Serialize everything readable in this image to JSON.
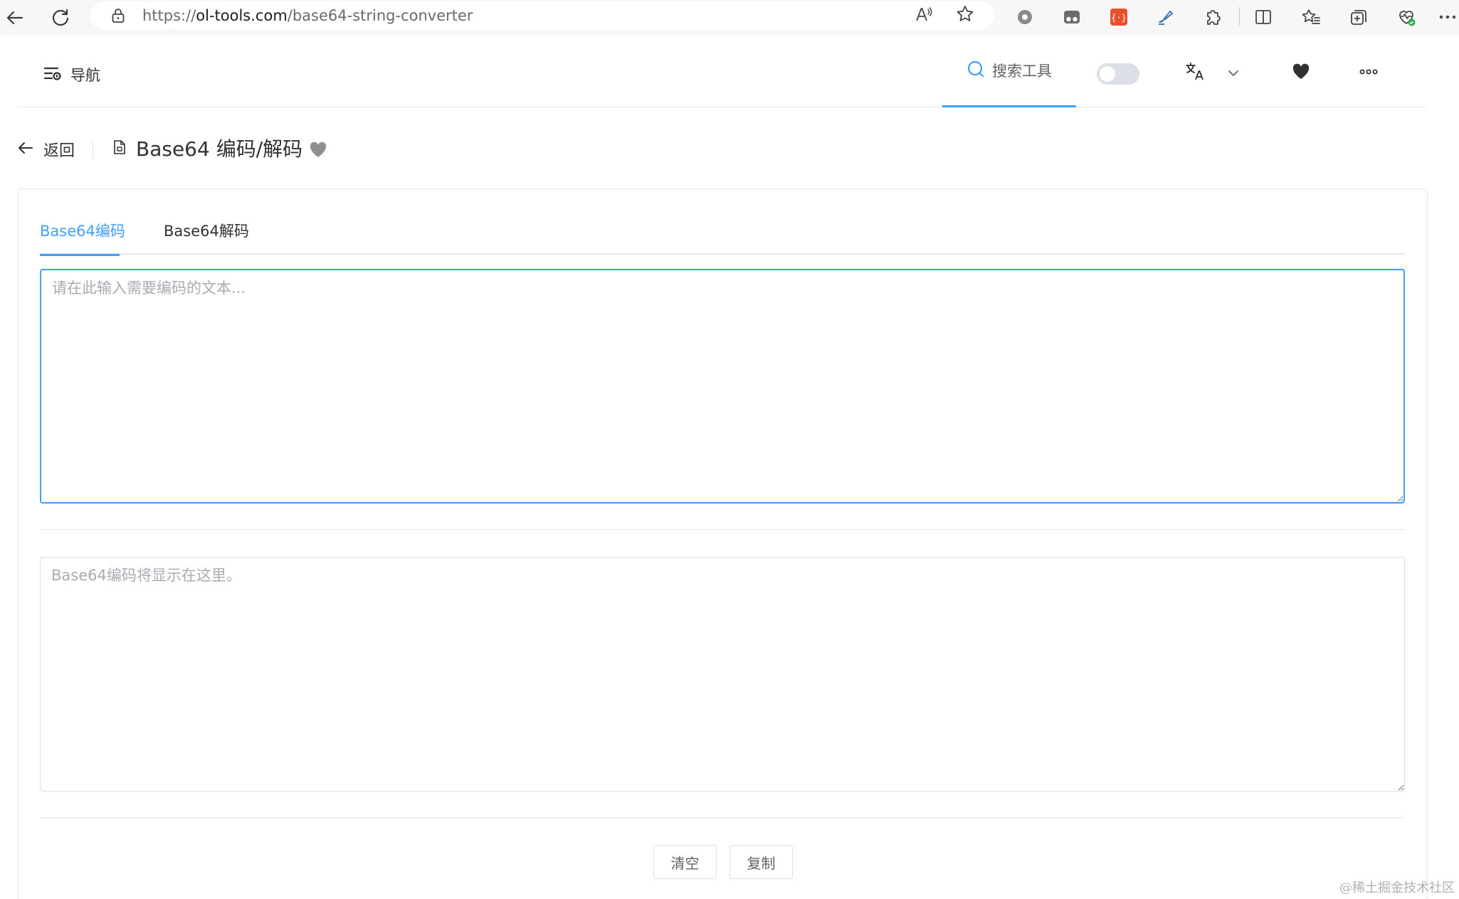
{
  "browser": {
    "url_prefix": "https://",
    "url_domain": "ol-tools.com",
    "url_path": "/base64-string-converter",
    "read_aloud_label": "A͈",
    "icons": [
      "back-arrow-icon",
      "refresh-icon",
      "lock-icon",
      "read-aloud-icon",
      "favorite-star-icon",
      "extension-icons",
      "split-screen-icon",
      "favorites-icon",
      "collections-icon",
      "browser-essentials-icon",
      "more-icon"
    ]
  },
  "header": {
    "nav_label": "导航",
    "search_label": "搜索工具",
    "accent_color": "#409eff"
  },
  "page": {
    "back_label": "返回",
    "title": "Base64 编码/解码"
  },
  "tabs": [
    {
      "label": "Base64编码",
      "active": true
    },
    {
      "label": "Base64解码",
      "active": false
    }
  ],
  "input": {
    "placeholder": "请在此输入需要编码的文本...",
    "value": ""
  },
  "output": {
    "placeholder": "Base64编码将显示在这里。",
    "value": ""
  },
  "actions": {
    "clear_label": "清空",
    "copy_label": "复制"
  },
  "watermark": "@稀土掘金技术社区"
}
